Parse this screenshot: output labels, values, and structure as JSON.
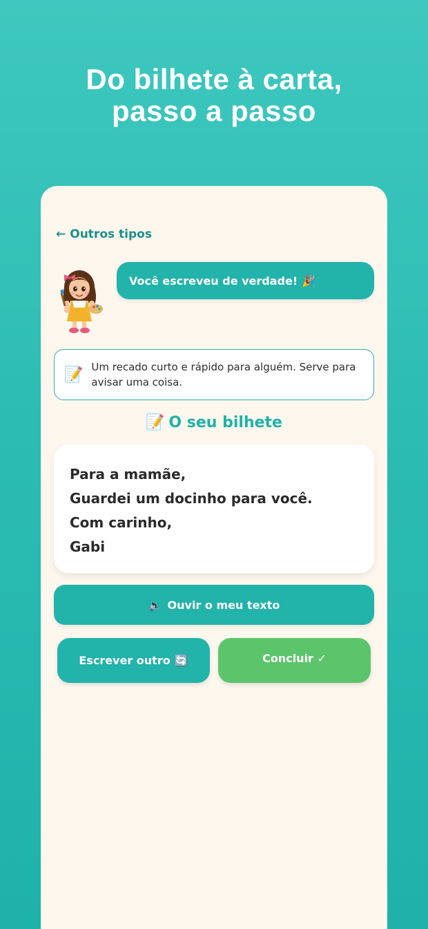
{
  "headline": {
    "line1": "Do bilhete à carta,",
    "line2": "passo a passo"
  },
  "nav": {
    "back_arrow": "←",
    "back_label": "Outros tipos"
  },
  "mascot": {
    "icon": "girl-painter-icon"
  },
  "bubble": {
    "message": "Você escreveu de verdade!",
    "emoji": "🎉"
  },
  "info": {
    "icon": "📝",
    "text": "Um recado curto e rápido para alguém. Serve para avisar uma coisa."
  },
  "section": {
    "icon": "📝",
    "title": "O seu bilhete"
  },
  "note": {
    "lines": [
      "Para a mamãe,",
      "Guardei um docinho para você.",
      "Com carinho,",
      "Gabi"
    ]
  },
  "actions": {
    "listen_icon": "🔈",
    "listen_label": "Ouvir o meu texto",
    "another_label": "Escrever outro",
    "another_icon": "🔄",
    "finish_label": "Concluir ✓"
  },
  "colors": {
    "teal": "#22b3aa",
    "green": "#5cc56b",
    "card_bg": "#fdf7ee"
  }
}
